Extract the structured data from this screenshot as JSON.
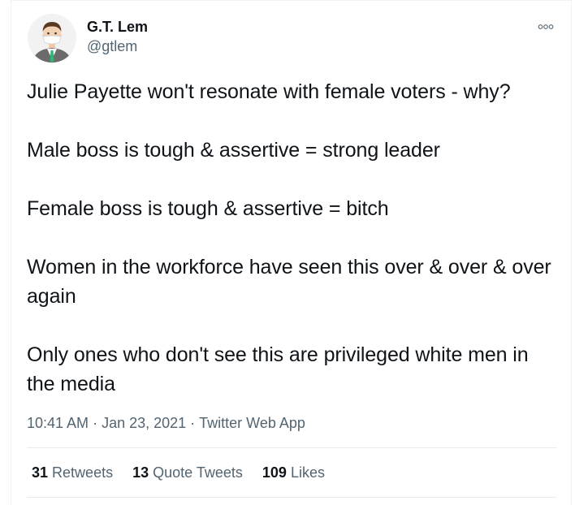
{
  "author": {
    "display_name": "G.T. Lem",
    "handle": "@gtlem",
    "avatar": "masked-man-avatar-icon"
  },
  "more_icon": "more-horizontal-icon",
  "tweet": {
    "paragraphs": [
      "Julie Payette won't resonate with female voters - why?",
      "Male boss is tough & assertive = strong leader",
      "Female boss is tough & assertive = bitch",
      "Women in the workforce have seen this over & over & over again",
      "Only ones who don't see this are privileged white men in the media"
    ]
  },
  "meta": {
    "time": "10:41 AM",
    "separator": "·",
    "date": "Jan 23, 2021",
    "source": "Twitter Web App"
  },
  "stats": {
    "retweets": {
      "count": "31",
      "label": "Retweets"
    },
    "quote_tweets": {
      "count": "13",
      "label": "Quote Tweets"
    },
    "likes": {
      "count": "109",
      "label": "Likes"
    }
  },
  "colors": {
    "text_primary": "#0f1419",
    "text_secondary": "#536471",
    "divider": "#e6ecf0"
  }
}
